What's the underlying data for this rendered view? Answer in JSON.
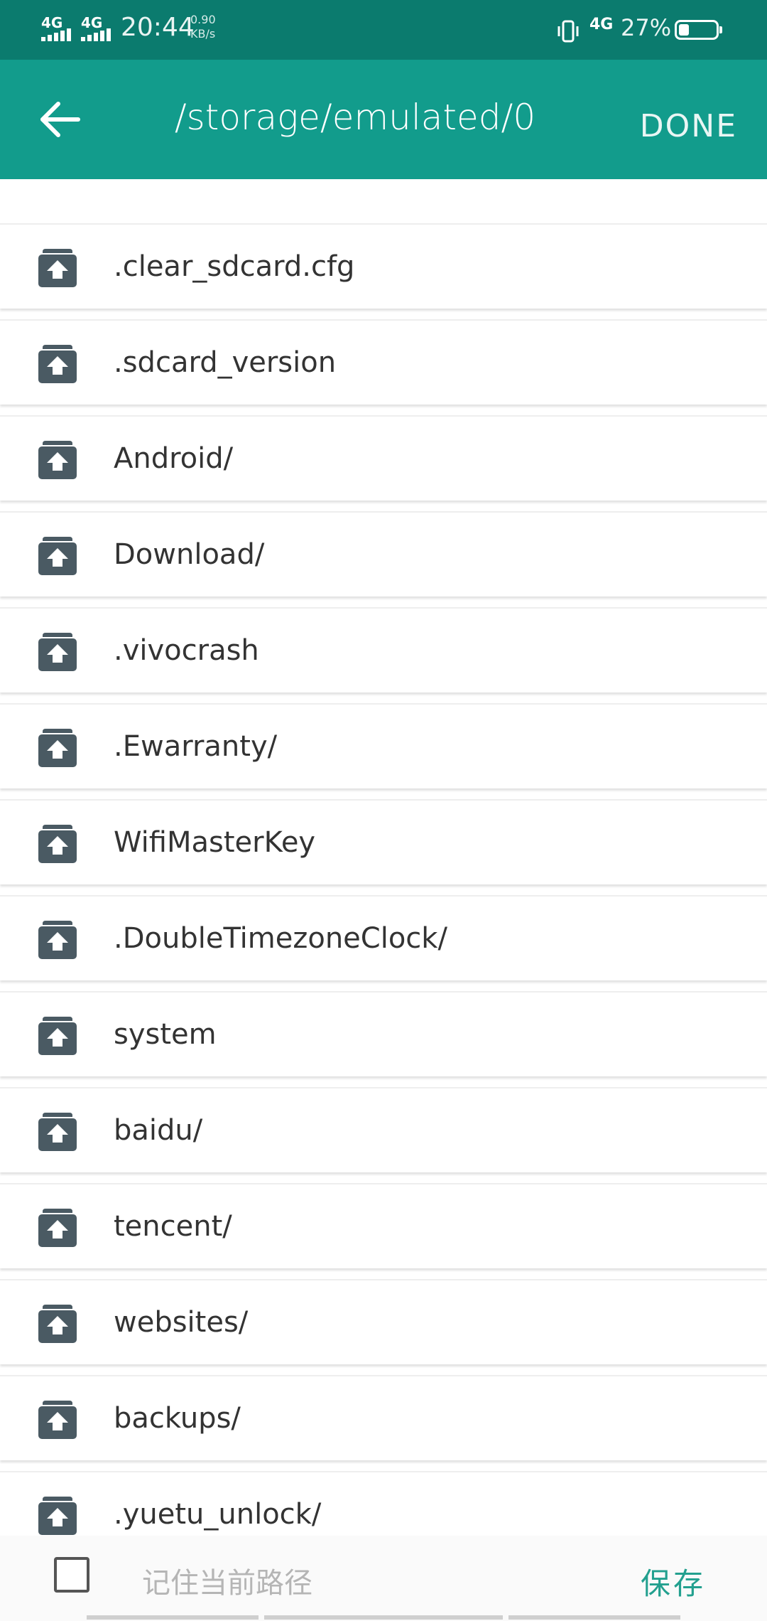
{
  "status": {
    "sim1": "4G",
    "sim2": "4G",
    "time": "20:44",
    "speed_value": "0.90",
    "speed_unit": "KB/s",
    "net": "4G",
    "battery": "27%",
    "battery_level": 0.27
  },
  "appbar": {
    "path": "/storage/emulated/0",
    "done": "DONE"
  },
  "files": [
    ".clear_sdcard.cfg",
    ".sdcard_version",
    "Android/",
    "Download/",
    ".vivocrash",
    ".Ewarranty/",
    "WifiMasterKey",
    ".DoubleTimezoneClock/",
    "system",
    "baidu/",
    "tencent/",
    "websites/",
    "backups/",
    ".yuetu_unlock/"
  ],
  "footer": {
    "remember_label": "记住当前路径",
    "remember_checked": false,
    "save": "保存"
  },
  "colors": {
    "status_bar": "#0b7b6e",
    "app_bar": "#129c8c",
    "accent": "#23a08f",
    "icon": "#4a5a63"
  }
}
